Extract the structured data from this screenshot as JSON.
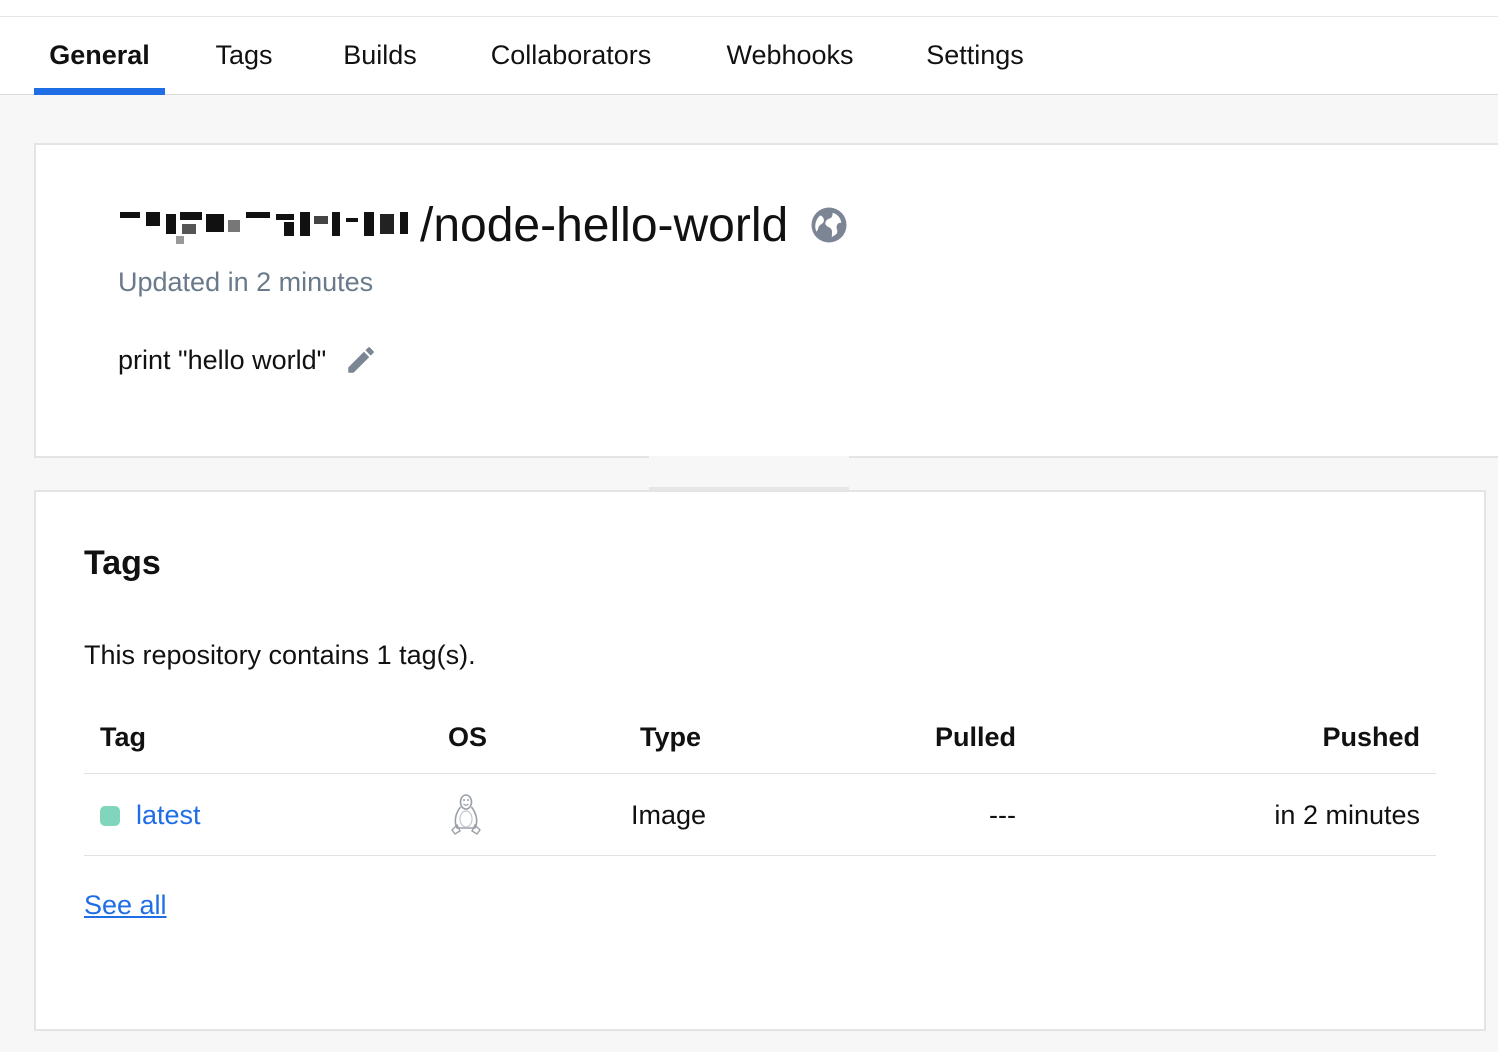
{
  "tabs": [
    {
      "label": "General",
      "active": true
    },
    {
      "label": "Tags",
      "active": false
    },
    {
      "label": "Builds",
      "active": false
    },
    {
      "label": "Collaborators",
      "active": false
    },
    {
      "label": "Webhooks",
      "active": false
    },
    {
      "label": "Settings",
      "active": false
    }
  ],
  "repo": {
    "name_suffix": "/node-hello-world",
    "visibility_icon": "globe-icon",
    "updated": "Updated in 2 minutes",
    "description": "print \"hello world\"",
    "edit_icon": "pencil-icon"
  },
  "tags_section": {
    "title": "Tags",
    "summary": "This repository contains 1 tag(s).",
    "columns": [
      "Tag",
      "OS",
      "Type",
      "Pulled",
      "Pushed"
    ],
    "rows": [
      {
        "tag": "latest",
        "os_icon": "linux-icon",
        "type": "Image",
        "pulled": "---",
        "pushed": "in 2 minutes",
        "status_color": "#7fd6bd"
      }
    ],
    "see_all": "See all"
  },
  "colors": {
    "accent": "#1f6ee6",
    "muted_text": "#6b7a8a",
    "icon_gray": "#7b8594",
    "status_active": "#7fd6bd"
  }
}
